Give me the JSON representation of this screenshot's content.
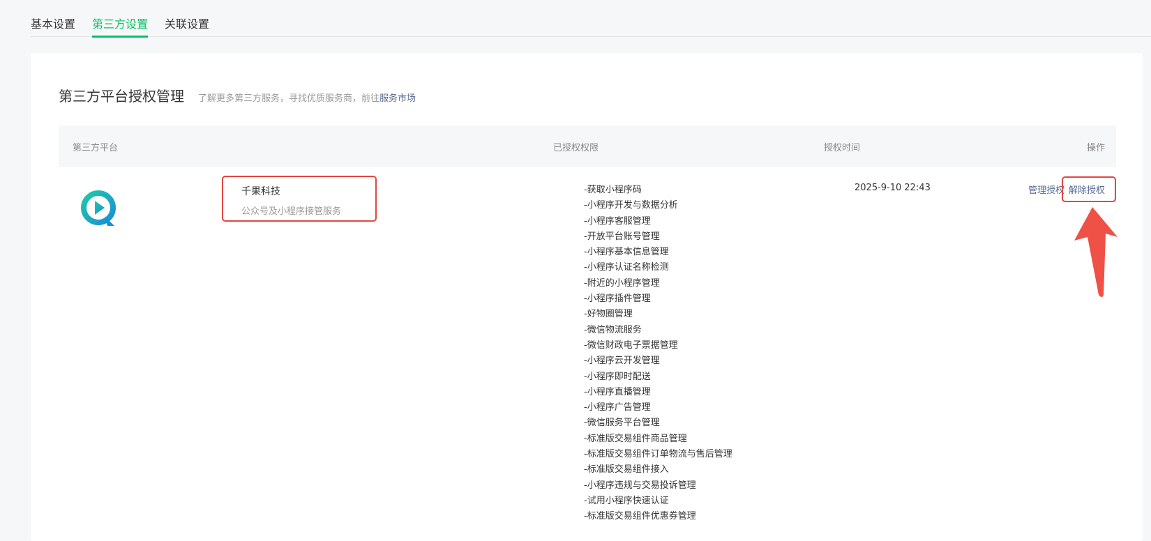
{
  "tabs": [
    "基本设置",
    "第三方设置",
    "关联设置"
  ],
  "active_tab": 1,
  "section": {
    "title": "第三方平台授权管理",
    "subtitle": "了解更多第三方服务，寻找优质服务商，前往",
    "link": "服务市场"
  },
  "table": {
    "headers": [
      "第三方平台",
      "已授权权限",
      "授权时间",
      "操作"
    ],
    "rows": [
      {
        "name": "千果科技",
        "desc": "公众号及小程序接管服务",
        "date": "2025-9-10 22:43",
        "actions": [
          "管理授权",
          "解除授权"
        ],
        "permissions": [
          "-获取小程序码",
          "-小程序开发与数据分析",
          "-小程序客服管理",
          "-开放平台账号管理",
          "-小程序基本信息管理",
          "-小程序认证名称检测",
          "-附近的小程序管理",
          "-小程序插件管理",
          "-好物圈管理",
          "-微信物流服务",
          "-微信财政电子票据管理",
          "-小程序云开发管理",
          "-小程序即时配送",
          "-小程序直播管理",
          "-小程序广告管理",
          "-微信服务平台管理",
          "-标准版交易组件商品管理",
          "-标准版交易组件订单物流与售后管理",
          "-标准版交易组件接入",
          "-小程序违规与交易投诉管理",
          "-试用小程序快速认证",
          "-标准版交易组件优惠券管理"
        ]
      }
    ]
  },
  "colors": {
    "accent": "#07c160",
    "link": "#576b95",
    "annotation": "#e5463f"
  }
}
